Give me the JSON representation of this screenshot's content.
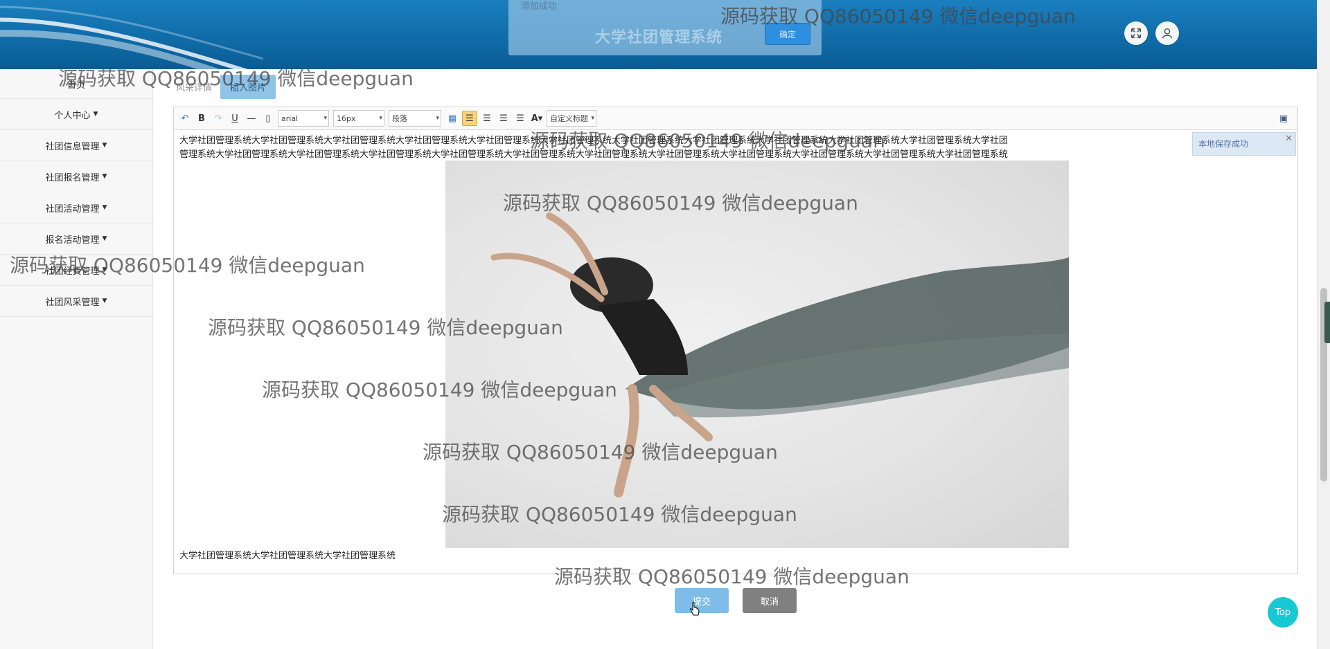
{
  "header": {
    "title": "大学社团管理系统",
    "fullscreen_icon": "expand-icon",
    "user_icon": "user-icon"
  },
  "toast": {
    "message": "添加成功",
    "ok_label": "确定"
  },
  "sidebar": {
    "items": [
      {
        "label": "首页"
      },
      {
        "label": "个人中心"
      },
      {
        "label": "社团信息管理"
      },
      {
        "label": "社团报名管理"
      },
      {
        "label": "社团活动管理"
      },
      {
        "label": "报名活动管理"
      },
      {
        "label": "社团经费管理"
      },
      {
        "label": "社团风采管理"
      }
    ]
  },
  "form": {
    "field_label": "风采详情",
    "insert_image_label": "插入图片"
  },
  "editor": {
    "toolbar": {
      "font_family": "arial",
      "font_size": "16px",
      "paragraph": "段落",
      "custom_heading": "自定义标题"
    },
    "content_line_1": "大学社团管理系统大学社团管理系统大学社团管理系统大学社团管理系统大学社团管理系统大学社团管理系统大学社团管理系统大学社团管理系统大学社团管理系统大学社团管理系统大学社团管理系统大学社团",
    "content_line_2": "管理系统大学社团管理系统大学社团管理系统大学社团管理系统大学社团管理系统大学社团管理系统大学社团管理系统大学社团管理系统大学社团管理系统大学社团管理系统大学社团管理系统大学社团管理系统",
    "content_line_last": "大学社团管理系统大学社团管理系统大学社团管理系统",
    "autosave_note": "本地保存成功"
  },
  "actions": {
    "submit_label": "提交",
    "cancel_label": "取消",
    "top_label": "Top"
  },
  "watermark": {
    "text": "源码获取 QQ86050149 微信deepguan"
  },
  "colors": {
    "header_blue": "#0f6aa6",
    "submit_blue": "#7fbde8",
    "cancel_gray": "#808080",
    "top_cyan": "#17c9d3"
  }
}
